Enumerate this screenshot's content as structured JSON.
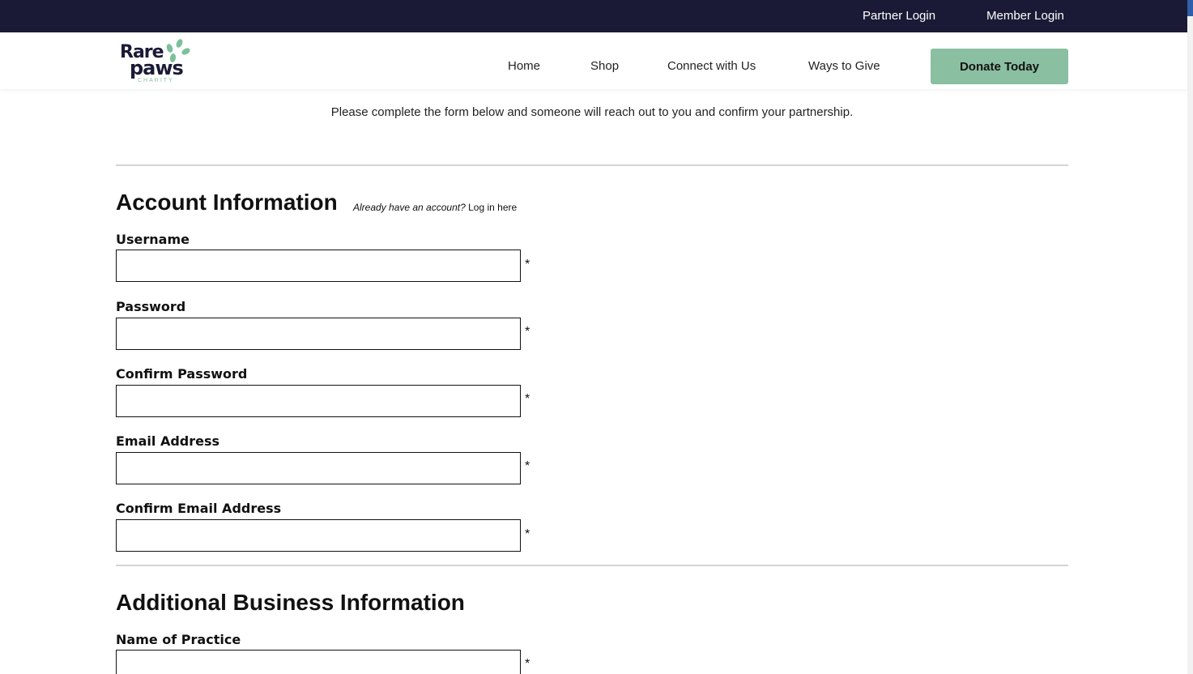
{
  "topbar": {
    "partner_login": "Partner Login",
    "member_login": "Member Login"
  },
  "logo": {
    "line1": "Rare",
    "line2": "paws",
    "line3": "CHARITY"
  },
  "nav": {
    "home": "Home",
    "shop": "Shop",
    "connect": "Connect with Us",
    "ways": "Ways to Give",
    "donate": "Donate Today"
  },
  "intro": "Please complete the form below and someone will reach out to you and confirm your partnership.",
  "account": {
    "title": "Account Information",
    "already_q": "Already have an account?",
    "login_link": "Log in here",
    "fields": [
      {
        "label": "Username",
        "value": "",
        "required": "*"
      },
      {
        "label": "Password",
        "value": "",
        "required": "*"
      },
      {
        "label": "Confirm Password",
        "value": "",
        "required": "*"
      },
      {
        "label": "Email Address",
        "value": "",
        "required": "*"
      },
      {
        "label": "Confirm Email Address",
        "value": "",
        "required": "*"
      }
    ]
  },
  "business": {
    "title": "Additional Business Information",
    "fields": [
      {
        "label": "Name of Practice",
        "value": "",
        "required": "*"
      }
    ]
  },
  "colors": {
    "topbar": "#1b1a36",
    "accent": "#8bbfa2",
    "logo_leaf": "#7cc09b"
  }
}
